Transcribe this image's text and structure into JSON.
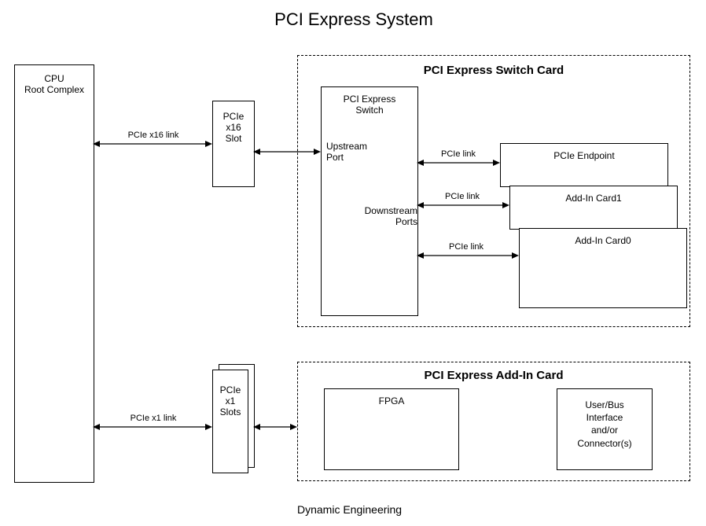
{
  "title": "PCI Express System",
  "footer": "Dynamic Engineering",
  "cpu": {
    "line1": "CPU",
    "line2": "Root Complex"
  },
  "slot_x16": {
    "line1": "PCIe",
    "line2": "x16",
    "line3": "Slot"
  },
  "slot_x1": {
    "line1": "PCIe",
    "line2": "x1",
    "line3": "Slots"
  },
  "switch_card": {
    "title": "PCI Express Switch Card",
    "switch_box": {
      "title": "PCI Express",
      "title2": "Switch",
      "upstream": "Upstream",
      "upstream2": "Port",
      "downstream": "Downstream",
      "downstream2": "Ports"
    },
    "endpoint": "PCIe Endpoint",
    "addin1": "Add-In Card1",
    "addin0": "Add-In Card0"
  },
  "addin_card": {
    "title": "PCI Express Add-In Card",
    "fpga": "FPGA",
    "userbus": {
      "l1": "User/Bus",
      "l2": "Interface",
      "l3": "and/or",
      "l4": "Connector(s)"
    }
  },
  "links": {
    "x16": "PCIe x16 link",
    "x1": "PCIe x1 link",
    "pcie": "PCIe link"
  }
}
